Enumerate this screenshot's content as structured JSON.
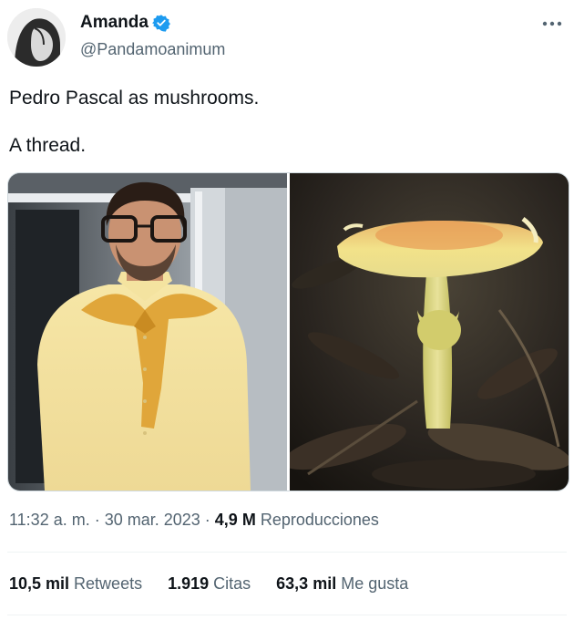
{
  "user": {
    "name": "Amanda",
    "handle": "@Pandamoanimum",
    "verified": true
  },
  "tweet": {
    "line1": "Pedro Pascal as mushrooms.",
    "line2": "A thread."
  },
  "media": {
    "left_icon": "person-photo",
    "right_icon": "mushroom-photo"
  },
  "meta": {
    "time": "11:32 a. m.",
    "sep1": " · ",
    "date": "30 mar. 2023",
    "sep2": " · ",
    "views_count": "4,9 M",
    "views_label": " Reproducciones"
  },
  "stats": {
    "retweets_count": "10,5 mil",
    "retweets_label": " Retweets",
    "quotes_count": "1.919",
    "quotes_label": " Citas",
    "likes_count": "63,3 mil",
    "likes_label": " Me gusta"
  },
  "colors": {
    "verified": "#1d9bf0",
    "secondary_text": "#536471",
    "primary_text": "#0f1419"
  }
}
